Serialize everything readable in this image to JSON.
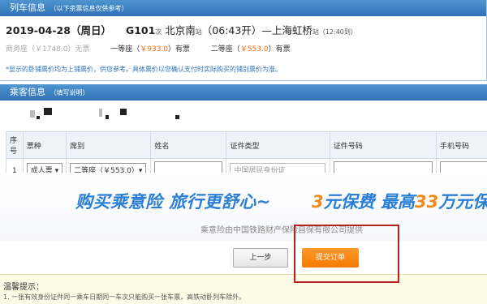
{
  "train_panel": {
    "title": "列车信息",
    "title_note": "（以下余票信息仅供参考）",
    "date": "2019-04-28（周日）",
    "train_no": "G101",
    "train_suffix": "次",
    "from_station": "北京南",
    "station_suffix_1": "站",
    "depart": "（06:43开）—",
    "to_station": "上海虹桥",
    "station_suffix_2": "站",
    "arrive": "（12:40到）",
    "seat_business": "商务座（￥1748.0）无票",
    "seat_first_label": "一等座（",
    "seat_first_price": "￥933.0",
    "seat_first_status": "）有票",
    "seat_second_label": "二等座（",
    "seat_second_price": "￥553.0",
    "seat_second_status": "）有票",
    "note": "*显示的卧铺票价均为上铺票价，供您参考。具体票价以您确认支付时实际购买的铺别票价为准。"
  },
  "passenger_panel": {
    "title": "乘客信息",
    "title_note": "（填写说明）",
    "columns": [
      "序号",
      "票种",
      "席别",
      "姓名",
      "证件类型",
      "证件号码",
      "手机号码"
    ],
    "row": {
      "index": "1",
      "ticket_type": "成人票 ▾",
      "seat_class": "二等座（￥553.0）▾",
      "id_type": "中国居民身份证"
    }
  },
  "banner": {
    "slogan": "购买乘意险  旅行更舒心~",
    "offer_num1": "3",
    "offer_text1": "元保费  最高",
    "offer_num2": "33",
    "offer_text2": "万元保",
    "provider": "乘意险由中国铁路财产保险自保有限公司提供"
  },
  "buttons": {
    "prev": "上一步",
    "submit": "提交订单"
  },
  "tips": {
    "title": "温馨提示：",
    "line1": "1. 一张有效身份证件同一乘车日期同一车次只能购买一张车票，高铁动卧列车除外。"
  },
  "colors": {
    "header_blue": "#2f73b6",
    "price_orange": "#ff6600",
    "submit_orange": "#f57a00",
    "highlight_red": "#b3201f"
  }
}
